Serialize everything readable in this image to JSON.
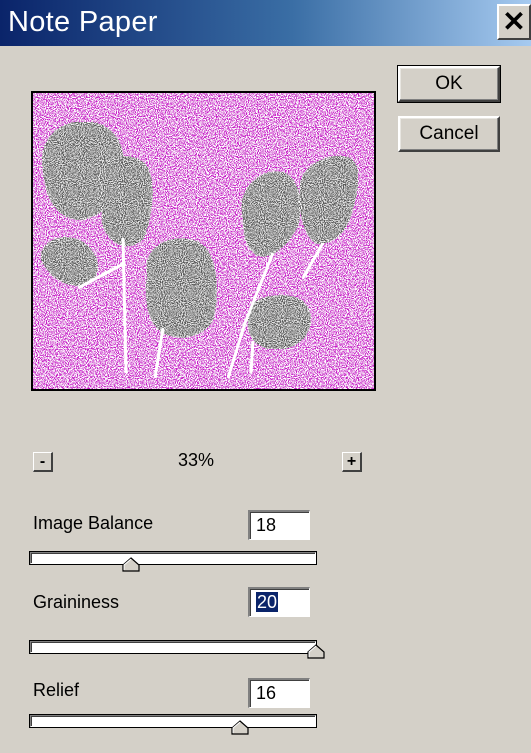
{
  "dialog": {
    "title": "Note Paper",
    "close_glyph": "✕"
  },
  "buttons": {
    "ok_label": "OK",
    "cancel_label": "Cancel"
  },
  "preview": {
    "zoom_minus_label": "-",
    "zoom_plus_label": "+",
    "zoom_level": "33%",
    "colors": {
      "background": "#c81ec8",
      "shapes": "#e6e6e6"
    }
  },
  "controls": [
    {
      "label": "Image Balance",
      "value": "18",
      "fraction": 0.35
    },
    {
      "label": "Graininess",
      "value": "20",
      "fraction": 1.0
    },
    {
      "label": "Relief",
      "value": "16",
      "fraction": 0.64
    }
  ]
}
